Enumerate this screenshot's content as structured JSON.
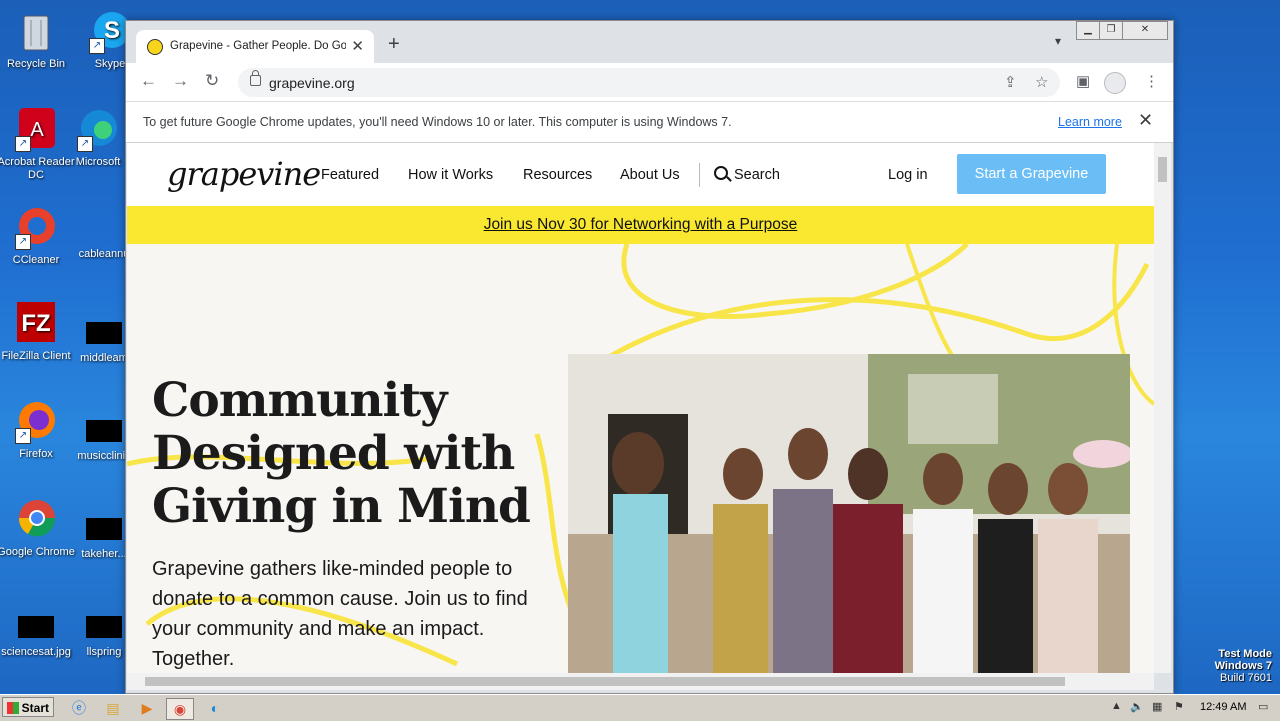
{
  "desktop": {
    "icons": [
      {
        "label": "Recycle Bin"
      },
      {
        "label": "Skype"
      },
      {
        "label": "Acrobat Reader DC"
      },
      {
        "label": "Microsoft"
      },
      {
        "label": "CCleaner"
      },
      {
        "label": "cableannu"
      },
      {
        "label": "FileZilla Client"
      },
      {
        "label": "middleam"
      },
      {
        "label": "Firefox"
      },
      {
        "label": "musicclinic"
      },
      {
        "label": "Google Chrome"
      },
      {
        "label": "takeher..."
      },
      {
        "label": "sciencesat.jpg"
      },
      {
        "label": "llspring"
      }
    ]
  },
  "browser": {
    "tab_title": "Grapevine - Gather People. Do Good",
    "url": "grapevine.org",
    "infobar_message": "To get future Google Chrome updates, you'll need Windows 10 or later. This computer is using Windows 7.",
    "infobar_link": "Learn more"
  },
  "site": {
    "logo": "grapevine",
    "nav": [
      "Featured",
      "How it Works",
      "Resources",
      "About Us",
      "Search"
    ],
    "login": "Log in",
    "cta": "Start a Grapevine",
    "banner": "Join us Nov 30 for Networking with a Purpose",
    "hero_title": "Community Designed with Giving in Mind",
    "hero_text": "Grapevine gathers like-minded people to donate to a common cause. Join us to find your community and make an impact. Together."
  },
  "taskbar": {
    "start_label": "Start",
    "clock": "12:49 AM"
  },
  "watermark": {
    "line1": "Test Mode",
    "line2": "Windows 7",
    "line3": "Build 7601"
  },
  "colors": {
    "banner": "#fae72f",
    "cta": "#6bbef5"
  }
}
